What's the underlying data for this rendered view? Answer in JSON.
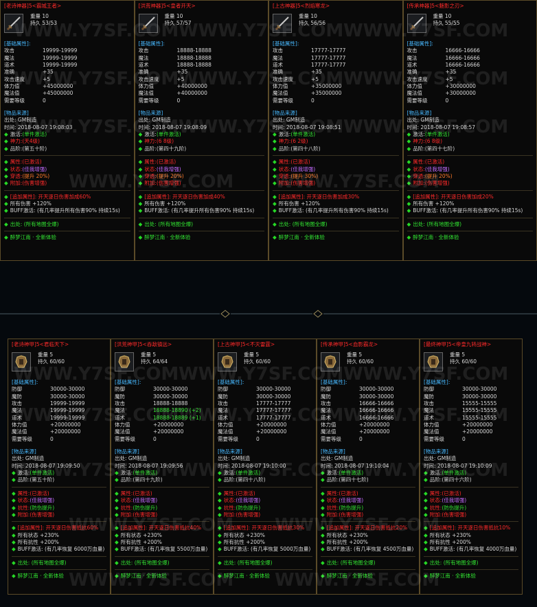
{
  "watermark": "WWW.Y7SF.COM",
  "weapons": [
    {
      "title": "[老诗神器]5<霸城王者>",
      "weight": "重量 10",
      "durability": "持久 53/53",
      "base_title": "[基础属性]:",
      "stats": [
        [
          "攻击",
          "19999-19999"
        ],
        [
          "魔法",
          "19999-19999"
        ],
        [
          "道术",
          "19999-19999"
        ],
        [
          "准确",
          "+35"
        ],
        [
          "攻击速度",
          "+5"
        ],
        [
          "体力值",
          "+45000000"
        ],
        [
          "魔法值",
          "+45000000"
        ],
        [
          "需要等级",
          "0"
        ]
      ],
      "src_title": "[物品来源]",
      "src_from": "出处: GM制造",
      "src_time": "时间: 2018-08-07 19:08:03",
      "rows": [
        [
          "激活:",
          "(单件激活)",
          "green"
        ],
        [
          "神力:",
          "(天4级)",
          "red"
        ],
        [
          "品阶:",
          "(第五十阶)",
          "plain"
        ]
      ],
      "attrs": [
        [
          "属性:",
          "(已激活)",
          "red"
        ],
        [
          "状态:",
          "(佳我增强)",
          "pink"
        ],
        [
          "穿透:",
          "(提升 20%)",
          "orange"
        ],
        [
          "附加:",
          "(伤害增强)",
          "red"
        ]
      ],
      "extra": "[追加属性]: 开天逐日伤害加成60%",
      "dmg": "所有伤害 +120%",
      "buff": "BUFF激活: (有几率提升所有伤害90% 持续15s)",
      "origin": "出处: (所有地图全爆)",
      "footer": "醉梦江南 · 全新体验"
    },
    {
      "title": "[洪荒神器]5<皇者开天>",
      "weight": "重量 10",
      "durability": "持久 57/57",
      "base_title": "[基础属性]:",
      "stats": [
        [
          "攻击",
          "18888-18888"
        ],
        [
          "魔法",
          "18888-18888"
        ],
        [
          "道术",
          "18888-18888"
        ],
        [
          "准确",
          "+35"
        ],
        [
          "攻击速度",
          "+5"
        ],
        [
          "体力值",
          "+40000000"
        ],
        [
          "魔法值",
          "+40000000"
        ],
        [
          "需要等级",
          "0"
        ]
      ],
      "src_title": "[物品来源]",
      "src_from": "出处: GM制造",
      "src_time": "时间: 2018-08-07 19:08:09",
      "rows": [
        [
          "激活:",
          "(单件激活)",
          "green"
        ],
        [
          "神力:",
          "(6 8级)",
          "red"
        ],
        [
          "品阶:",
          "(第四十九阶)",
          "plain"
        ]
      ],
      "attrs": [
        [
          "属性:",
          "(已激活)",
          "red"
        ],
        [
          "状态:",
          "(佳我增强)",
          "pink"
        ],
        [
          "穿透:",
          "(提升 20%)",
          "orange"
        ],
        [
          "附加:",
          "(伤害增强)",
          "red"
        ]
      ],
      "extra": "[追加属性]: 开天逐日伤害加成40%",
      "dmg": "所有伤害 +120%",
      "buff": "BUFF激活: (有几率提升所有伤害90% 持续15s)",
      "origin": "出处: (所有地图全爆)",
      "footer": "醉梦江南 · 全新体验"
    },
    {
      "title": "[上古神器]5<烈焰寒龙>",
      "weight": "重量 10",
      "durability": "持久 56/56",
      "base_title": "[基础属性]:",
      "stats": [
        [
          "攻击",
          "17777-17777"
        ],
        [
          "魔法",
          "17777-17777"
        ],
        [
          "道术",
          "17777-17777"
        ],
        [
          "准确",
          "+35"
        ],
        [
          "攻击速度",
          "+5"
        ],
        [
          "体力值",
          "+35000000"
        ],
        [
          "魔法值",
          "+35000000"
        ],
        [
          "需要等级",
          "0"
        ]
      ],
      "src_title": "[物品来源]",
      "src_from": "出处: GM制造",
      "src_time": "时间: 2018-08-07 19:08:51",
      "rows": [
        [
          "激活:",
          "(单件激活)",
          "green"
        ],
        [
          "神力:",
          "(6 2级)",
          "red"
        ],
        [
          "品阶:",
          "(第四十八阶)",
          "plain"
        ]
      ],
      "attrs": [
        [
          "属性:",
          "(已激活)",
          "red"
        ],
        [
          "状态:",
          "(佳我增强)",
          "pink"
        ],
        [
          "穿透:",
          "(提升 30%)",
          "orange"
        ],
        [
          "附加:",
          "(伤害增强)",
          "red"
        ]
      ],
      "extra": "[追加属性]: 开天逐日伤害加成30%",
      "dmg": "所有伤害 +120%",
      "buff": "BUFF激活: (有几率提升所有伤害90% 持续15s)",
      "origin": "出处: (所有地图全爆)",
      "footer": "醉梦江南 · 全新体验"
    },
    {
      "title": "[传承神器]5<魅影之刃>",
      "weight": "重量 10",
      "durability": "持久 55/55",
      "base_title": "[基础属性]:",
      "stats": [
        [
          "攻击",
          "16666-16666"
        ],
        [
          "魔法",
          "16666-16666"
        ],
        [
          "道术",
          "16666-16666"
        ],
        [
          "准确",
          "+35"
        ],
        [
          "攻击速度",
          "+5"
        ],
        [
          "体力值",
          "+30000000"
        ],
        [
          "魔法值",
          "+30000000"
        ],
        [
          "需要等级",
          "0"
        ]
      ],
      "src_title": "[物品来源]",
      "src_from": "出处: GM制造",
      "src_time": "时间: 2018-08-07 19:08:57",
      "rows": [
        [
          "激活:",
          "(单件激活)",
          "green"
        ],
        [
          "神力:",
          "(6 8级)",
          "red"
        ],
        [
          "品阶:",
          "(第四十七阶)",
          "plain"
        ]
      ],
      "attrs": [
        [
          "属性:",
          "(已激活)",
          "red"
        ],
        [
          "状态:",
          "(佳我增强)",
          "pink"
        ],
        [
          "穿透:",
          "(提升 20%)",
          "orange"
        ],
        [
          "附加:",
          "(伤害增强)",
          "red"
        ]
      ],
      "extra": "[追加属性]: 开天逐日伤害加成20%",
      "dmg": "所有伤害 +120%",
      "buff": "BUFF激活: (有几率提升所有伤害90% 持续15s)",
      "origin": "出处: (所有地图全爆)",
      "footer": "醉梦江南 · 全新体验"
    }
  ],
  "armors": [
    {
      "title": "[老诗神甲]5<君临天下>",
      "weight": "重量 5",
      "durability": "持久 60/60",
      "base_title": "[基础属性]:",
      "stats": [
        [
          "防御",
          "30000-30000",
          ""
        ],
        [
          "魔防",
          "30000-30000",
          ""
        ],
        [
          "攻击",
          "19999-19999",
          ""
        ],
        [
          "魔法",
          "19999-19999",
          ""
        ],
        [
          "道术",
          "19999-19999",
          ""
        ],
        [
          "体力值",
          "+20000000",
          ""
        ],
        [
          "魔法值",
          "+20000000",
          ""
        ],
        [
          "需要等级",
          "0",
          ""
        ]
      ],
      "src_title": "[物品来源]",
      "src_from": "出处: GM制造",
      "src_time": "时间: 2018-08-07 19:09:50",
      "rows": [
        [
          "激活:",
          "(单件激活)",
          "green"
        ],
        [
          "品阶:",
          "(第五十阶)",
          "plain"
        ]
      ],
      "attrs": [
        [
          "属性:",
          "(已激活)",
          "red"
        ],
        [
          "状态:",
          "(佳我增强)",
          "pink"
        ],
        [
          "抗性:",
          "(防伤提升)",
          "plain"
        ],
        [
          "附加:",
          "(伤害增强)",
          "red"
        ]
      ],
      "extra": "[追加属性]: 开天逐日伤害抵抗60%",
      "s1": "所有状态 +230%",
      "s2": "所有抗性 +200%",
      "buff": "BUFF激活: (有几率恢复 6000万血量)",
      "origin": "出处: (所有地图全爆)",
      "footer": "醉梦江南 · 全新体验"
    },
    {
      "title": "[洪荒神甲]5<吞敌镇远>",
      "weight": "重量 5",
      "durability": "持久 64/64",
      "base_title": "[基础属性]:",
      "stats": [
        [
          "防御",
          "30000-30000",
          ""
        ],
        [
          "魔防",
          "30000-30000",
          ""
        ],
        [
          "攻击",
          "18888-18888",
          ""
        ],
        [
          "魔法",
          "18888-18890 (+2)",
          "green"
        ],
        [
          "道术",
          "18888-18889 (+1)",
          "green"
        ],
        [
          "体力值",
          "+20000000",
          ""
        ],
        [
          "魔法值",
          "+20000000",
          ""
        ],
        [
          "需要等级",
          "0",
          ""
        ]
      ],
      "src_title": "[物品来源]",
      "src_from": "出处: GM制造",
      "src_time": "时间: 2018-08-07 19:09:56",
      "rows": [
        [
          "激活:",
          "(单件激活)",
          "green"
        ],
        [
          "品阶:",
          "(第四十九阶)",
          "plain"
        ]
      ],
      "attrs": [
        [
          "属性:",
          "(已激活)",
          "red"
        ],
        [
          "状态:",
          "(佳我增强)",
          "pink"
        ],
        [
          "抗性:",
          "(防伤提升)",
          "plain"
        ],
        [
          "附加:",
          "(伤害增强)",
          "red"
        ]
      ],
      "extra": "[追加属性]: 开天逐日伤害抵抗40%",
      "s1": "所有状态 +230%",
      "s2": "所有抗性 +200%",
      "buff": "BUFF激活: (有几率恢复 5500万血量)",
      "origin": "出处: (所有地图全爆)",
      "footer": "醉梦江南 · 全新体验"
    },
    {
      "title": "[上古神甲]5<不灭雷霆>",
      "weight": "重量 5",
      "durability": "持久 60/60",
      "base_title": "[基础属性]:",
      "stats": [
        [
          "防御",
          "30000-30000",
          ""
        ],
        [
          "魔防",
          "30000-30000",
          ""
        ],
        [
          "攻击",
          "17777-17777",
          ""
        ],
        [
          "魔法",
          "17777-17777",
          ""
        ],
        [
          "道术",
          "17777-17777",
          ""
        ],
        [
          "体力值",
          "+20000000",
          ""
        ],
        [
          "魔法值",
          "+20000000",
          ""
        ],
        [
          "需要等级",
          "0",
          ""
        ]
      ],
      "src_title": "[物品来源]",
      "src_from": "出处: GM制造",
      "src_time": "时间: 2018-08-07 19:10:00",
      "rows": [
        [
          "激活:",
          "(单件激活)",
          "green"
        ],
        [
          "品阶:",
          "(第四十八阶)",
          "plain"
        ]
      ],
      "attrs": [
        [
          "属性:",
          "(已激活)",
          "red"
        ],
        [
          "状态:",
          "(佳我增强)",
          "pink"
        ],
        [
          "抗性:",
          "(防伤提升)",
          "plain"
        ],
        [
          "附加:",
          "(伤害增强)",
          "red"
        ]
      ],
      "extra": "[追加属性]: 开天逐日伤害抵抗30%",
      "s1": "所有状态 +230%",
      "s2": "所有抗性 +200%",
      "buff": "BUFF激活: (有几率恢复 5000万血量)",
      "origin": "出处: (所有地图全爆)",
      "footer": "醉梦江南 · 全新体验"
    },
    {
      "title": "[传承神甲]5<血影霸龙>",
      "weight": "重量 5",
      "durability": "持久 60/60",
      "base_title": "[基础属性]:",
      "stats": [
        [
          "防御",
          "30000-30000",
          ""
        ],
        [
          "魔防",
          "30000-30000",
          ""
        ],
        [
          "攻击",
          "16666-16666",
          ""
        ],
        [
          "魔法",
          "16666-16666",
          ""
        ],
        [
          "道术",
          "16666-16666",
          ""
        ],
        [
          "体力值",
          "+20000000",
          ""
        ],
        [
          "魔法值",
          "+20000000",
          ""
        ],
        [
          "需要等级",
          "0",
          ""
        ]
      ],
      "src_title": "[物品来源]",
      "src_from": "出处: GM制造",
      "src_time": "时间: 2018-08-07 19:10:04",
      "rows": [
        [
          "激活:",
          "(单件激活)",
          "green"
        ],
        [
          "品阶:",
          "(第四十七阶)",
          "plain"
        ]
      ],
      "attrs": [
        [
          "属性:",
          "(已激活)",
          "red"
        ],
        [
          "状态:",
          "(佳我增强)",
          "pink"
        ],
        [
          "抗性:",
          "(防伤提升)",
          "plain"
        ],
        [
          "附加:",
          "(伤害增强)",
          "red"
        ]
      ],
      "extra": "[追加属性]: 开天逐日伤害抵抗20%",
      "s1": "所有状态 +230%",
      "s2": "所有抗性 +200%",
      "buff": "BUFF激活: (有几率恢复 4500万血量)",
      "origin": "出处: (所有地图全爆)",
      "footer": "醉梦江南 · 全新体验"
    },
    {
      "title": "[最终神甲]5<帝皇九转战神>",
      "weight": "重量 5",
      "durability": "持久 60/60",
      "base_title": "[基础属性]:",
      "stats": [
        [
          "防御",
          "30000-30000",
          ""
        ],
        [
          "魔防",
          "30000-30000",
          ""
        ],
        [
          "攻击",
          "15555-15555",
          ""
        ],
        [
          "魔法",
          "15555-15555",
          ""
        ],
        [
          "道术",
          "15555-15555",
          ""
        ],
        [
          "体力值",
          "+20000000",
          ""
        ],
        [
          "魔法值",
          "+20000000",
          ""
        ],
        [
          "需要等级",
          "0",
          ""
        ]
      ],
      "src_title": "[物品来源]",
      "src_from": "出处: GM制造",
      "src_time": "时间: 2018-08-07 19:10:09",
      "rows": [
        [
          "激活:",
          "(单件激活)",
          "green"
        ],
        [
          "品阶:",
          "(第四十六阶)",
          "plain"
        ]
      ],
      "attrs": [
        [
          "属性:",
          "(已激活)",
          "red"
        ],
        [
          "状态:",
          "(佳我增强)",
          "pink"
        ],
        [
          "抗性:",
          "(防伤提升)",
          "plain"
        ],
        [
          "附加:",
          "(伤害增强)",
          "red"
        ]
      ],
      "extra": "[追加属性]: 开天逐日伤害抵抗10%",
      "s1": "所有状态 +230%",
      "s2": "所有抗性 +200%",
      "buff": "BUFF激活: (有几率恢复 4000万血量)",
      "origin": "出处: (所有地图全爆)",
      "footer": "醉梦江南 · 全新体验"
    }
  ]
}
